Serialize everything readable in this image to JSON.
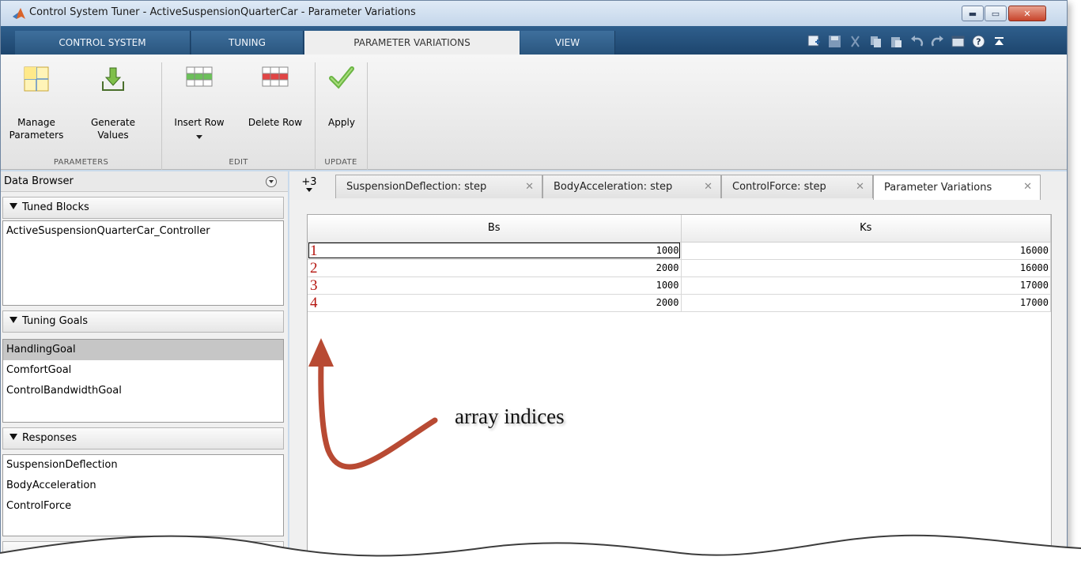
{
  "window": {
    "title": "Control System Tuner - ActiveSuspensionQuarterCar - Parameter Variations",
    "minimize_label": "▬",
    "maximize_label": "▭",
    "close_label": "✕"
  },
  "ribbon_tabs": [
    {
      "label": "CONTROL SYSTEM"
    },
    {
      "label": "TUNING"
    },
    {
      "label": "PARAMETER VARIATIONS",
      "active": true
    },
    {
      "label": "VIEW"
    }
  ],
  "quick_access": [
    "add-icon",
    "save-icon",
    "cut-icon",
    "copy-icon",
    "paste-icon",
    "undo-icon",
    "redo-icon",
    "window-layout-icon",
    "help-icon",
    "collapse-ribbon-icon"
  ],
  "ribbon": {
    "groups": [
      {
        "label": "PARAMETERS"
      },
      {
        "label": "EDIT"
      },
      {
        "label": "UPDATE"
      }
    ],
    "buttons": {
      "manage": "Manage\nParameters",
      "generate": "Generate\nValues",
      "insert": "Insert Row",
      "delete": "Delete Row",
      "apply": "Apply"
    }
  },
  "data_browser": {
    "title": "Data Browser",
    "tuned_blocks": {
      "header": "Tuned Blocks",
      "items": [
        "ActiveSuspensionQuarterCar_Controller"
      ]
    },
    "tuning_goals": {
      "header": "Tuning Goals",
      "items": [
        "HandlingGoal",
        "ComfortGoal",
        "ControlBandwidthGoal"
      ],
      "selected": "HandlingGoal"
    },
    "responses": {
      "header": "Responses",
      "items": [
        "SuspensionDeflection",
        "BodyAcceleration",
        "ControlForce"
      ]
    }
  },
  "document_tabs": {
    "overflow": "+3",
    "tabs": [
      {
        "label": "SuspensionDeflection: step"
      },
      {
        "label": "BodyAcceleration: step"
      },
      {
        "label": "ControlForce: step"
      },
      {
        "label": "Parameter Variations",
        "active": true
      }
    ],
    "close_glyph": "✕"
  },
  "table": {
    "columns": [
      "Bs",
      "Ks"
    ],
    "rows": [
      {
        "index": "1",
        "Bs": "1000",
        "Ks": "16000"
      },
      {
        "index": "2",
        "Bs": "2000",
        "Ks": "16000"
      },
      {
        "index": "3",
        "Bs": "1000",
        "Ks": "17000"
      },
      {
        "index": "4",
        "Bs": "2000",
        "Ks": "17000"
      }
    ]
  },
  "annotation": {
    "text": "array indices",
    "color": "#b84a33"
  },
  "colors": {
    "tabstrip": "#23507c",
    "row_index": "#b5150f",
    "selected_item": "#c6c6c6"
  }
}
